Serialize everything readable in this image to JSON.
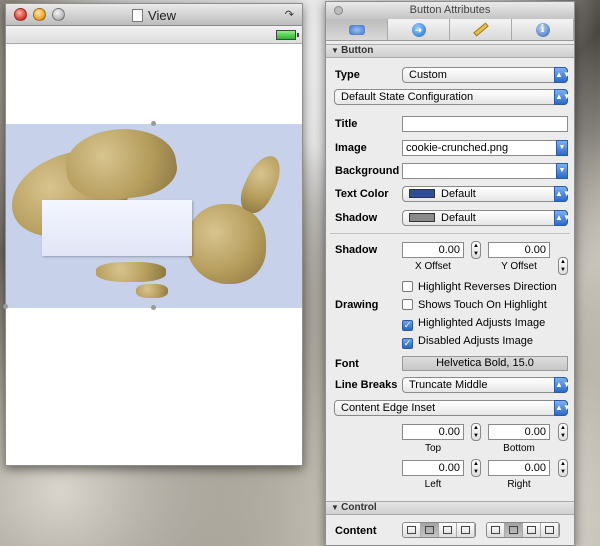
{
  "view_window": {
    "title": "View"
  },
  "attributes_window": {
    "title": "Button Attributes",
    "tabs": [
      {
        "icon": "attributes-icon"
      },
      {
        "icon": "connections-icon"
      },
      {
        "icon": "size-ruler-icon"
      },
      {
        "icon": "identity-info-icon"
      }
    ],
    "button_section": "Button",
    "type_label": "Type",
    "type_value": "Custom",
    "state_config": "Default State Configuration",
    "title_label": "Title",
    "title_value": "",
    "image_label": "Image",
    "image_value": "cookie-crunched.png",
    "background_label": "Background",
    "background_value": "",
    "text_color_label": "Text Color",
    "text_color_value": "Default",
    "text_color_swatch": "#2f4f8f",
    "shadow_color_label": "Shadow",
    "shadow_color_value": "Default",
    "shadow_color_swatch": "#8a8a8a",
    "shadow_offset_label": "Shadow",
    "shadow_x": "0.00",
    "shadow_y": "0.00",
    "x_offset_label": "X Offset",
    "y_offset_label": "Y Offset",
    "drawing_label": "Drawing",
    "drawing_options": [
      {
        "label": "Highlight Reverses Direction",
        "checked": false
      },
      {
        "label": "Shows Touch On Highlight",
        "checked": false
      },
      {
        "label": "Highlighted Adjusts Image",
        "checked": true
      },
      {
        "label": "Disabled Adjusts Image",
        "checked": true
      }
    ],
    "font_label": "Font",
    "font_value": "Helvetica Bold, 15.0",
    "line_breaks_label": "Line Breaks",
    "line_breaks_value": "Truncate Middle",
    "edge_inset": "Content Edge Inset",
    "inset_top": "0.00",
    "inset_bottom": "0.00",
    "inset_left": "0.00",
    "inset_right": "0.00",
    "top_label": "Top",
    "bottom_label": "Bottom",
    "left_label": "Left",
    "right_label": "Right",
    "control_section": "Control",
    "content_label": "Content"
  }
}
